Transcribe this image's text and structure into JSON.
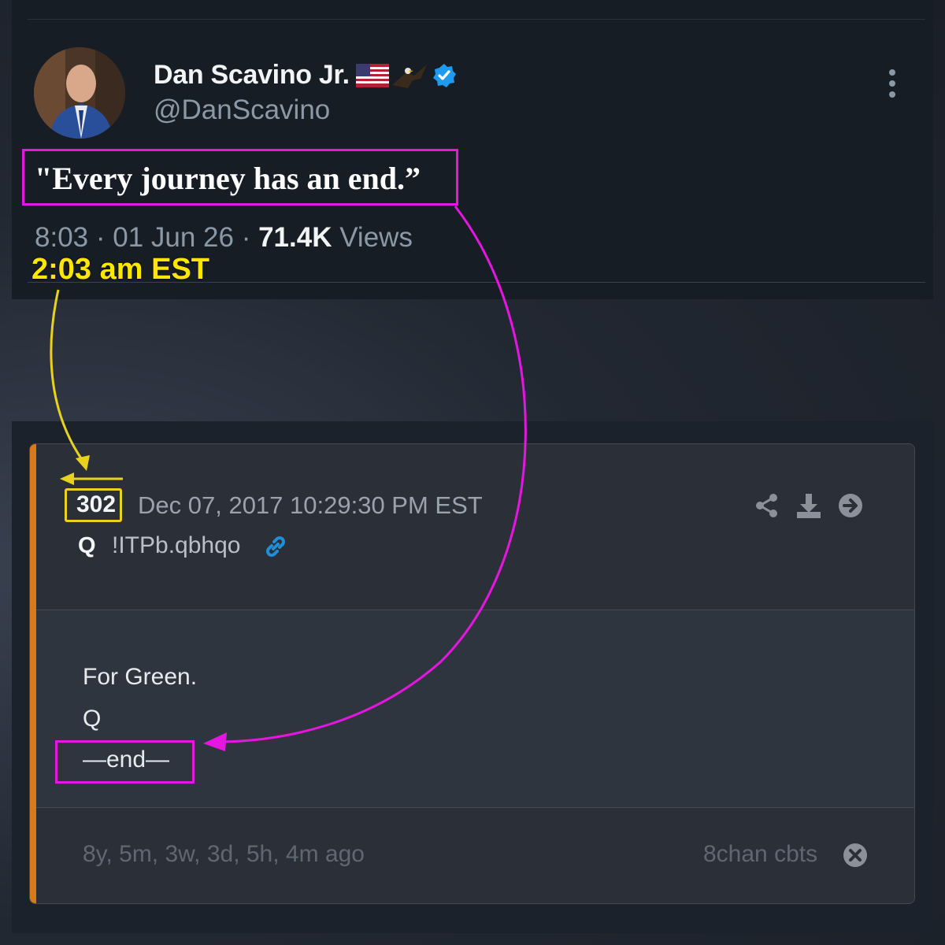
{
  "tweet": {
    "display_name": "Dan Scavino Jr.",
    "handle": "@DanScavino",
    "text": "\"Every journey has an end.”",
    "time": "8:03 · 01 Jun 26 · ",
    "views_count": "71.4K",
    "views_label": " Views",
    "icons": [
      "us-flag-icon",
      "eagle-icon",
      "verified-badge-icon",
      "more-options-icon"
    ]
  },
  "annotation": {
    "est_time": "2:03 am EST",
    "highlight_color_magenta": "#e516e0",
    "highlight_color_yellow": "#e8d21c"
  },
  "post": {
    "number": "302",
    "date": "Dec 07, 2017 10:29:30 PM EST",
    "author": "Q",
    "tripcode": "!ITPb.qbhqo",
    "body": [
      "For Green.",
      "Q",
      "—end—"
    ],
    "age": "8y, 5m, 3w, 3d, 5h, 4m ago",
    "source": "8chan cbts",
    "accent_color": "#d87a1a",
    "icons": [
      "share-icon",
      "download-icon",
      "open-arrow-icon",
      "link-icon",
      "close-icon"
    ]
  }
}
